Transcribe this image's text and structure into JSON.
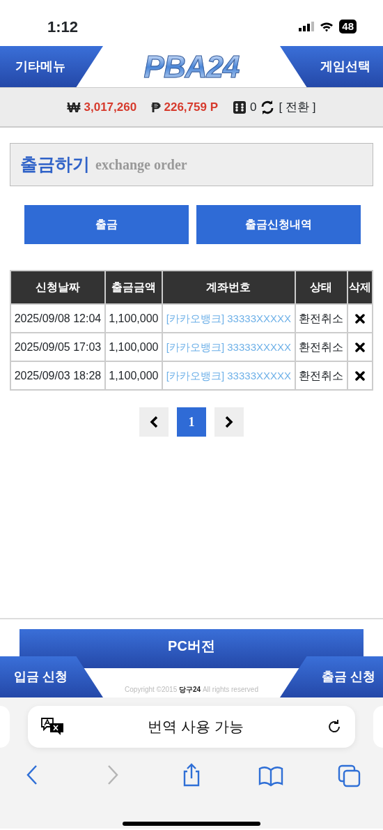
{
  "status_bar": {
    "time": "1:12",
    "battery": "48"
  },
  "header": {
    "left_tab": "기타메뉴",
    "logo": "PBA24",
    "right_tab": "게임선택"
  },
  "balance": {
    "won_symbol": "₩",
    "cash": "3,017,260",
    "point_symbol": "₱",
    "points": "226,759 P",
    "chips": "0",
    "convert": "[ 전환 ]"
  },
  "title": {
    "korean": "출금하기",
    "english": "exchange order"
  },
  "actions": [
    {
      "label": "출금"
    },
    {
      "label": "출금신청내역"
    }
  ],
  "table": {
    "columns": [
      "신청날짜",
      "출금금액",
      "계좌번호",
      "상태",
      "삭제"
    ],
    "rows": [
      {
        "date": "2025/09/08 12:04",
        "amount": "1,100,000",
        "account": "[카카오뱅크] 33333XXXXX",
        "status": "환전취소"
      },
      {
        "date": "2025/09/05 17:03",
        "amount": "1,100,000",
        "account": "[카카오뱅크] 33333XXXXX",
        "status": "환전취소"
      },
      {
        "date": "2025/09/03 18:28",
        "amount": "1,100,000",
        "account": "[카카오뱅크] 33333XXXXX",
        "status": "환전취소"
      }
    ]
  },
  "pagination": {
    "pages": [
      {
        "label": "1",
        "selected": true
      }
    ]
  },
  "footer": {
    "pc_button": "PC버전",
    "left_tab": "입금 신청",
    "right_tab": "출금 신청",
    "copyright": "Copyright ©2015 **당구24** All rights reserved"
  },
  "browser": {
    "address": "번역 사용 가능",
    "toolbar": [
      {
        "kind": "back",
        "disabled": false
      },
      {
        "kind": "forward",
        "disabled": true
      },
      {
        "kind": "share",
        "disabled": false
      },
      {
        "kind": "bookmarks",
        "disabled": false
      },
      {
        "kind": "tabs",
        "disabled": false
      }
    ]
  }
}
